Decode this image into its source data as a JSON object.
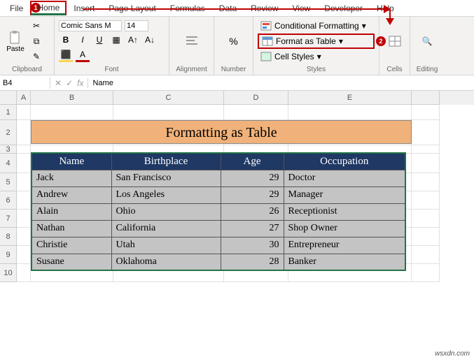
{
  "tabs": {
    "file": "File",
    "home": "Home",
    "insert": "Insert",
    "pagelayout": "Page Layout",
    "formulas": "Formulas",
    "data": "Data",
    "review": "Review",
    "view": "View",
    "developer": "Developer",
    "help": "Help"
  },
  "callouts": {
    "one": "1",
    "two": "2"
  },
  "ribbon": {
    "clipboard": {
      "paste": "Paste",
      "label": "Clipboard"
    },
    "font": {
      "name": "Comic Sans M",
      "size": "14",
      "bold": "B",
      "italic": "I",
      "underline": "U",
      "label": "Font"
    },
    "alignment": {
      "label": "Alignment"
    },
    "number": {
      "label": "Number"
    },
    "styles": {
      "cond": "Conditional Formatting",
      "fat": "Format as Table",
      "cell": "Cell Styles",
      "label": "Styles"
    },
    "cells": {
      "label": "Cells"
    },
    "editing": {
      "label": "Editing"
    }
  },
  "namebox": {
    "ref": "B4",
    "fx": "fx",
    "formula": "Name"
  },
  "cols": [
    "A",
    "B",
    "C",
    "D",
    "E"
  ],
  "rows": [
    "1",
    "2",
    "3",
    "4",
    "5",
    "6",
    "7",
    "8",
    "9",
    "10"
  ],
  "title": "Formatting as Table",
  "headers": {
    "name": "Name",
    "bp": "Birthplace",
    "age": "Age",
    "occ": "Occupation"
  },
  "data": [
    {
      "name": "Jack",
      "bp": "San Francisco",
      "age": "29",
      "occ": "Doctor"
    },
    {
      "name": "Andrew",
      "bp": "Los Angeles",
      "age": "29",
      "occ": "Manager"
    },
    {
      "name": "Alain",
      "bp": "Ohio",
      "age": "26",
      "occ": "Receptionist"
    },
    {
      "name": "Nathan",
      "bp": "California",
      "age": "27",
      "occ": "Shop Owner"
    },
    {
      "name": "Christie",
      "bp": "Utah",
      "age": "30",
      "occ": "Entrepreneur"
    },
    {
      "name": "Susane",
      "bp": "Oklahoma",
      "age": "28",
      "occ": "Banker"
    }
  ],
  "watermark": "wsxdn.com"
}
